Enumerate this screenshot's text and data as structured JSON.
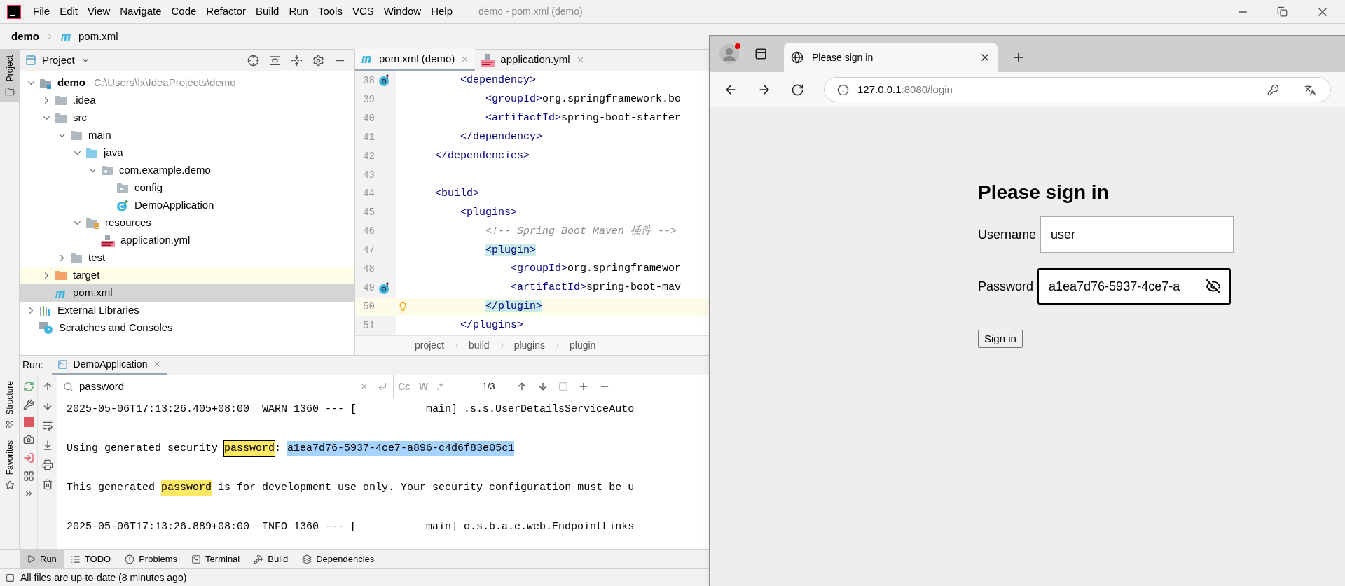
{
  "menubar": {
    "menus": [
      "File",
      "Edit",
      "View",
      "Navigate",
      "Code",
      "Refactor",
      "Build",
      "Run",
      "Tools",
      "VCS",
      "Window",
      "Help"
    ],
    "title": "demo - pom.xml (demo)"
  },
  "breadcrumb": [
    "demo",
    "pom.xml"
  ],
  "side_tabs": [
    {
      "label": "Project",
      "selected": true
    },
    {
      "label": "Structure",
      "selected": false
    },
    {
      "label": "Favorites",
      "selected": false
    }
  ],
  "project": {
    "title": "Project",
    "tree": [
      {
        "name": "demo",
        "path": "C:\\Users\\lx\\IdeaProjects\\demo",
        "kind": "module",
        "expanded": true,
        "selected": false,
        "children": [
          {
            "name": ".idea",
            "kind": "folder",
            "expanded": false,
            "selected": false
          },
          {
            "name": "src",
            "kind": "folder",
            "expanded": true,
            "selected": false,
            "children": [
              {
                "name": "main",
                "kind": "folder",
                "expanded": true,
                "selected": false,
                "children": [
                  {
                    "name": "java",
                    "kind": "source-folder",
                    "expanded": true,
                    "selected": false,
                    "children": [
                      {
                        "name": "com.example.demo",
                        "kind": "package",
                        "expanded": true,
                        "selected": false,
                        "children": [
                          {
                            "name": "config",
                            "kind": "package",
                            "selected": false
                          },
                          {
                            "name": "DemoApplication",
                            "kind": "class",
                            "selected": false
                          }
                        ]
                      }
                    ]
                  },
                  {
                    "name": "resources",
                    "kind": "resource-folder",
                    "expanded": true,
                    "selected": false,
                    "children": [
                      {
                        "name": "application.yml",
                        "kind": "yml",
                        "selected": false
                      }
                    ]
                  }
                ]
              },
              {
                "name": "test",
                "kind": "folder",
                "expanded": false,
                "selected": false
              }
            ]
          },
          {
            "name": "target",
            "kind": "excluded-folder",
            "expanded": false,
            "selected": false
          },
          {
            "name": "pom.xml",
            "kind": "maven",
            "selected": true
          }
        ]
      },
      {
        "name": "External Libraries",
        "kind": "libraries",
        "expanded": false,
        "selected": false
      },
      {
        "name": "Scratches and Consoles",
        "kind": "scratches",
        "selected": false
      }
    ]
  },
  "editor": {
    "tabs": [
      {
        "label": "pom.xml (demo)",
        "kind": "maven",
        "selected": true
      },
      {
        "label": "application.yml",
        "kind": "yml",
        "selected": false
      }
    ],
    "lines": [
      {
        "number": "38",
        "gutter": {
          "kind": "override"
        },
        "current": false,
        "segments": [
          {
            "t": "        <dependency>",
            "kind": "tag"
          }
        ]
      },
      {
        "number": "39",
        "current": false,
        "segments": [
          {
            "t": "            <groupId>",
            "kind": "tag"
          },
          {
            "t": "org.springframework.bo",
            "kind": "text"
          }
        ]
      },
      {
        "number": "40",
        "current": false,
        "segments": [
          {
            "t": "            <artifactId>",
            "kind": "tag"
          },
          {
            "t": "spring-boot-starter",
            "kind": "text"
          }
        ]
      },
      {
        "number": "41",
        "current": false,
        "segments": [
          {
            "t": "        </dependency>",
            "kind": "tag"
          }
        ]
      },
      {
        "number": "42",
        "current": false,
        "segments": [
          {
            "t": "    </dependencies>",
            "kind": "tag"
          }
        ]
      },
      {
        "number": "43",
        "current": false
      },
      {
        "number": "44",
        "current": false,
        "segments": [
          {
            "t": "    <build>",
            "kind": "tag"
          }
        ]
      },
      {
        "number": "45",
        "current": false,
        "segments": [
          {
            "t": "        <plugins>",
            "kind": "tag"
          }
        ]
      },
      {
        "number": "46",
        "current": false,
        "segments": [
          {
            "t": "            <!-- Spring Boot Maven 插件 -->",
            "kind": "comment"
          }
        ]
      },
      {
        "number": "47",
        "current": false,
        "segments": [
          {
            "t": "            <plugin>",
            "kind": "tag-match"
          }
        ]
      },
      {
        "number": "48",
        "current": false,
        "segments": [
          {
            "t": "                <groupId>",
            "kind": "tag"
          },
          {
            "t": "org.springframewor",
            "kind": "text"
          }
        ]
      },
      {
        "number": "49",
        "gutter": {
          "kind": "override"
        },
        "current": false,
        "segments": [
          {
            "t": "                <artifactId>",
            "kind": "tag"
          },
          {
            "t": "spring-boot-mav",
            "kind": "text"
          }
        ]
      },
      {
        "number": "50",
        "gutter": {
          "kind": "bulb"
        },
        "current": true,
        "segments": [
          {
            "t": "            </plugin>",
            "kind": "tag-match"
          }
        ]
      },
      {
        "number": "51",
        "current": false,
        "segments": [
          {
            "t": "        </plugins>",
            "kind": "tag"
          }
        ]
      }
    ],
    "breadcrumb": [
      "project",
      "build",
      "plugins",
      "plugin"
    ]
  },
  "run": {
    "label": "Run:",
    "tab": "DemoApplication",
    "search": {
      "value": "password",
      "count": "1/3",
      "options": [
        "Cc",
        "W",
        ".*"
      ]
    },
    "lines": [
      {
        "kind": "text",
        "segments": [
          {
            "t": "2025-05-06T17:13:26.405+08:00  WARN 1360 --- [           main] .s.s.UserDetailsServiceAuto",
            "kind": "text"
          }
        ]
      },
      {
        "kind": "blank"
      },
      {
        "kind": "text",
        "segments": [
          {
            "t": "Using generated security ",
            "kind": "text"
          },
          {
            "t": "password",
            "kind": "current-match"
          },
          {
            "t": ": ",
            "kind": "text"
          },
          {
            "t": "a1ea7d76-5937-4ce7-a896-c4d6f83e05c1",
            "kind": "selection"
          }
        ]
      },
      {
        "kind": "blank"
      },
      {
        "kind": "text",
        "segments": [
          {
            "t": "This generated ",
            "kind": "text"
          },
          {
            "t": "password",
            "kind": "match"
          },
          {
            "t": " is for development use only. Your security configuration must be u",
            "kind": "text"
          }
        ]
      },
      {
        "kind": "blank"
      },
      {
        "kind": "text",
        "segments": [
          {
            "t": "2025-05-06T17:13:26.889+08:00  INFO 1360 --- [           main] o.s.b.a.e.web.EndpointLinks",
            "kind": "text"
          }
        ]
      }
    ]
  },
  "bottom_tabs": [
    {
      "label": "Run",
      "kind": "run",
      "selected": true
    },
    {
      "label": "TODO",
      "kind": "todo",
      "selected": false
    },
    {
      "label": "Problems",
      "kind": "problems",
      "selected": false
    },
    {
      "label": "Terminal",
      "kind": "terminal",
      "selected": false
    },
    {
      "label": "Build",
      "kind": "build",
      "selected": false
    },
    {
      "label": "Dependencies",
      "kind": "dependencies",
      "selected": false
    }
  ],
  "status": "All files are up-to-date (8 minutes ago)",
  "browser": {
    "tab": "Please sign in",
    "url": {
      "host": "127.0.0.1",
      "rest": ":8080/login"
    },
    "page": {
      "heading": "Please sign in",
      "fields": [
        {
          "label": "Username",
          "value": "user",
          "focused": false,
          "kind": "text"
        },
        {
          "label": "Password",
          "value": "a1ea7d76-5937-4ce7-a",
          "focused": true,
          "kind": "password"
        }
      ],
      "button": "Sign in"
    }
  }
}
